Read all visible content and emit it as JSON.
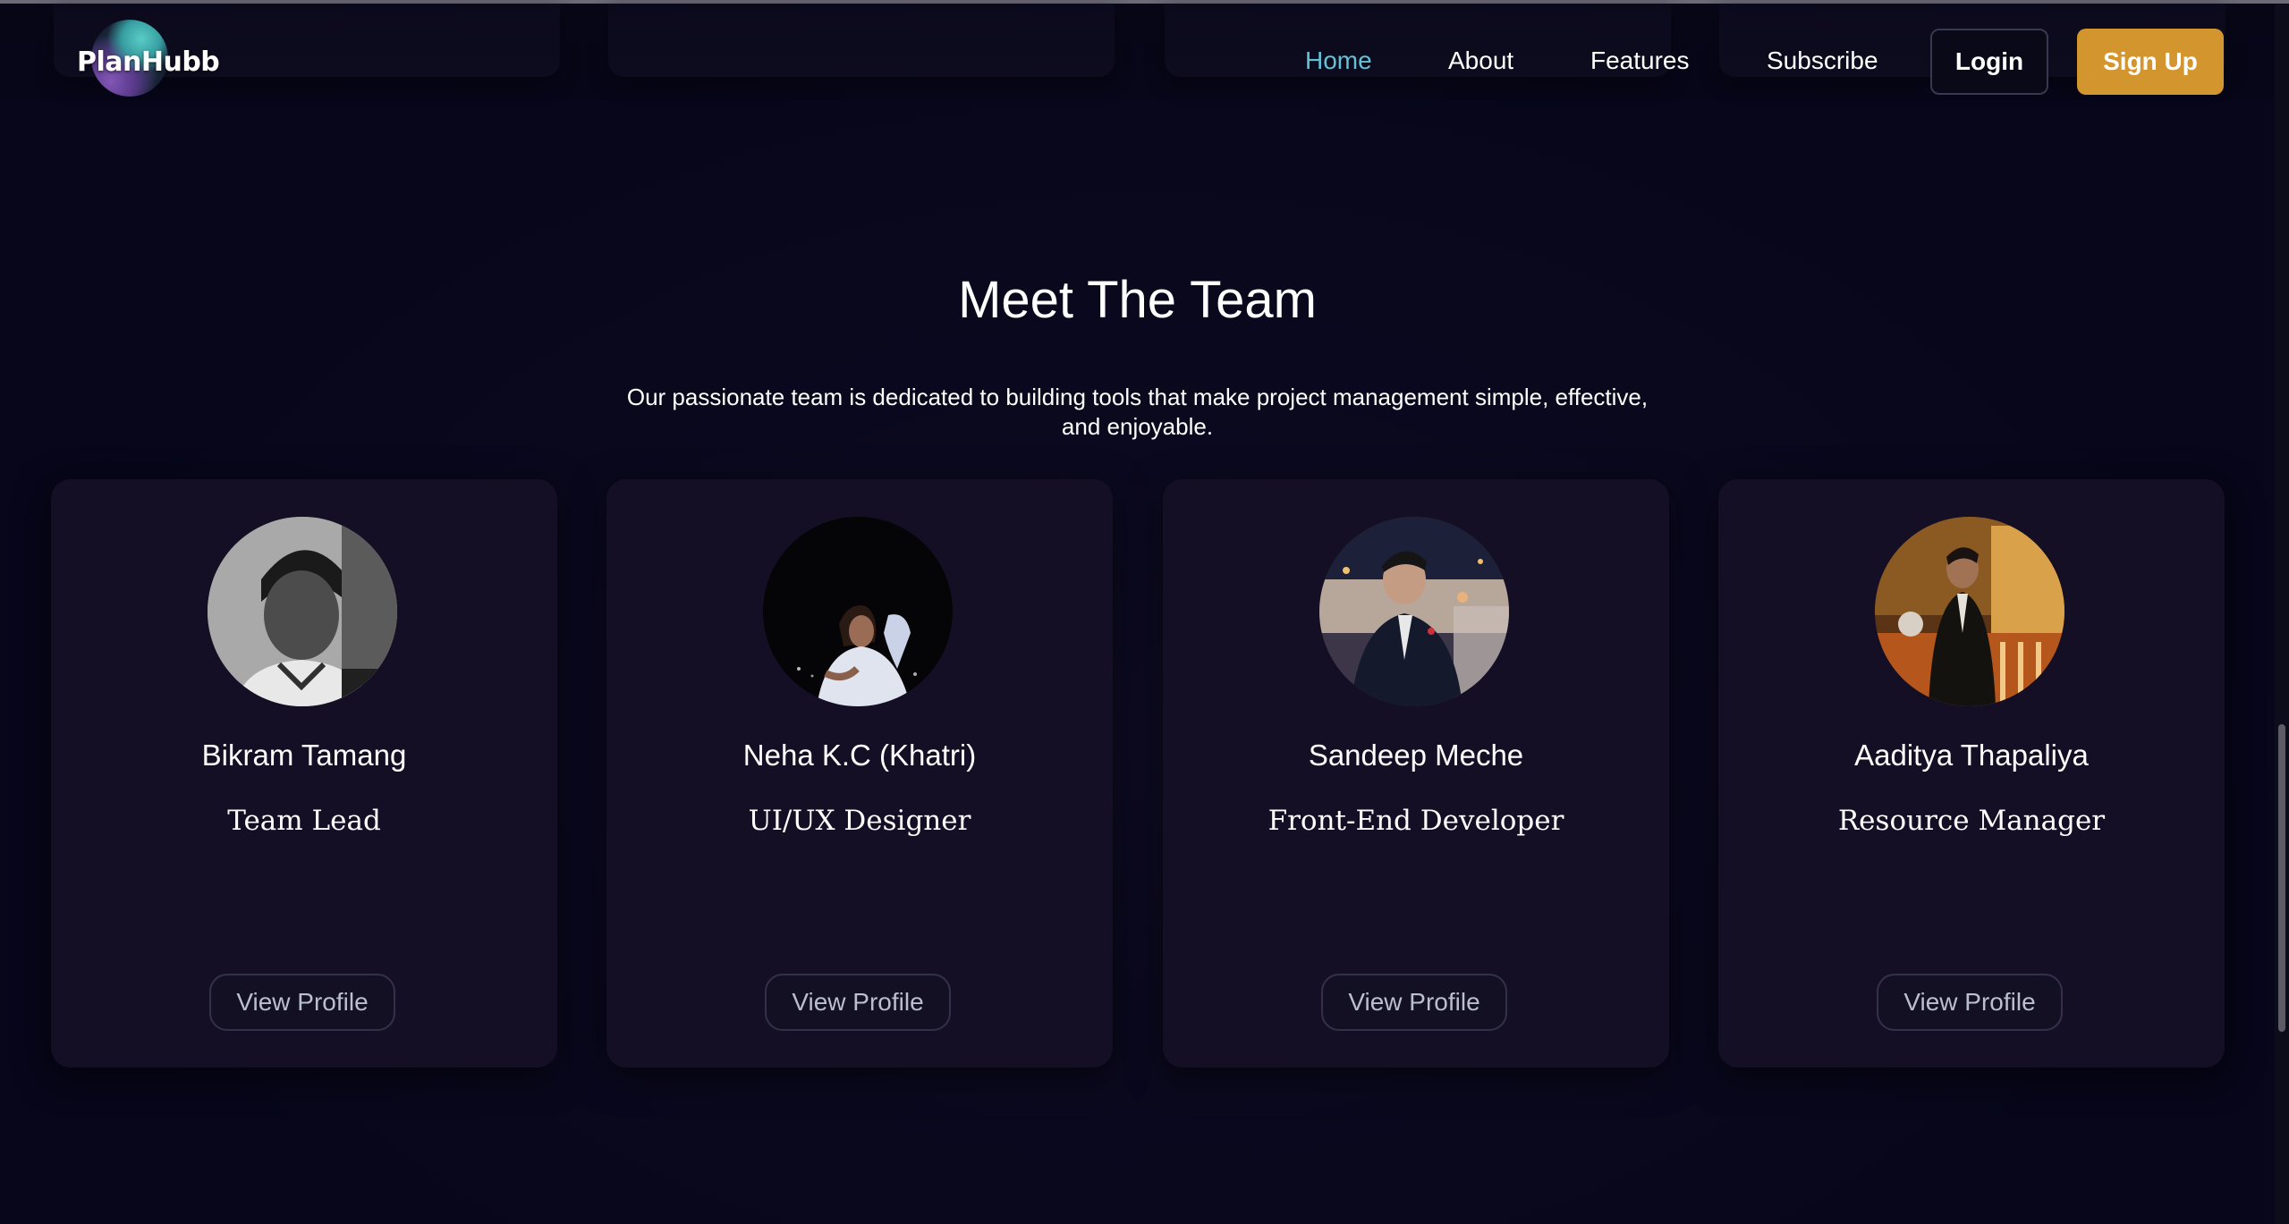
{
  "brand": {
    "logo_text": "PlanHubb"
  },
  "nav": {
    "items": [
      {
        "label": "Home",
        "active": true
      },
      {
        "label": "About",
        "active": false
      },
      {
        "label": "Features",
        "active": false
      },
      {
        "label": "Subscribe",
        "active": false
      }
    ],
    "login_label": "Login",
    "signup_label": "Sign Up"
  },
  "team": {
    "title": "Meet The Team",
    "description": "Our passionate team is dedicated to building tools that make project management simple, effective, and enjoyable.",
    "members": [
      {
        "name": "Bikram Tamang",
        "role": "Team Lead",
        "button_label": "View Profile"
      },
      {
        "name": "Neha K.C (Khatri)",
        "role": "UI/UX Designer",
        "button_label": "View Profile"
      },
      {
        "name": "Sandeep Meche",
        "role": "Front-End Developer",
        "button_label": "View Profile"
      },
      {
        "name": "Aaditya Thapaliya",
        "role": "Resource Manager",
        "button_label": "View Profile"
      }
    ]
  },
  "colors": {
    "background": "#07061a",
    "card": "#150f26",
    "accent_nav_active": "#63c2d6",
    "signup_button": "#d3962e"
  }
}
